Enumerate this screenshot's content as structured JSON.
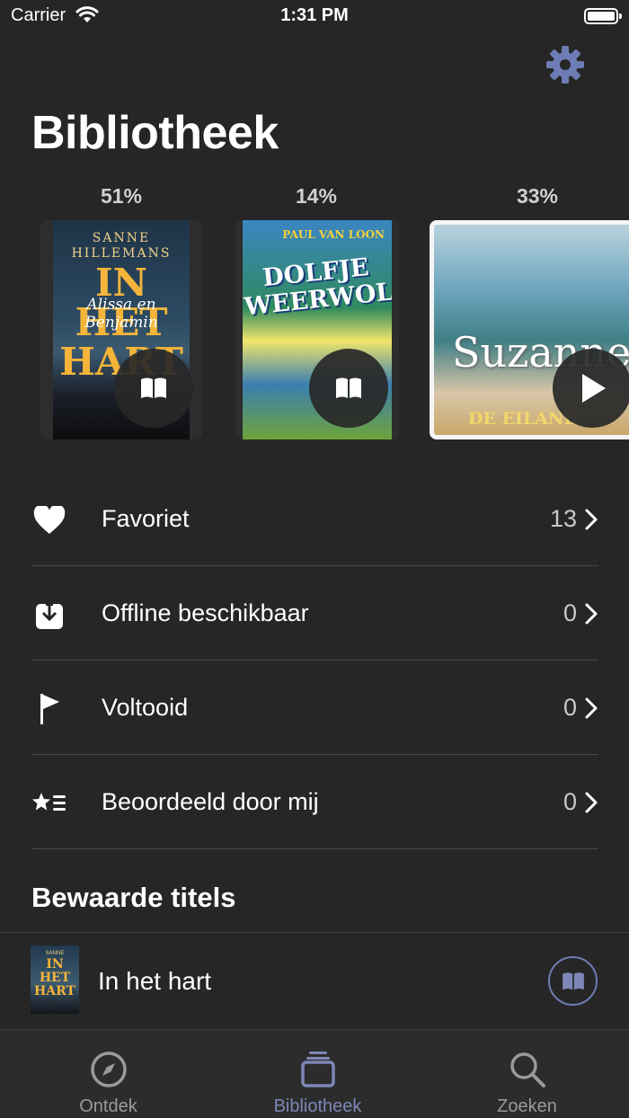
{
  "status_bar": {
    "carrier": "Carrier",
    "time": "1:31 PM"
  },
  "header": {
    "title": "Bibliotheek",
    "settings_icon": "gear-icon"
  },
  "carousel": [
    {
      "progress": "51%",
      "cover_author": "SANNE HILLEMANS",
      "cover_title": "IN HET HART",
      "cover_subtitle": "Alissa en Benjamin",
      "action_icon": "open-book-icon"
    },
    {
      "progress": "14%",
      "cover_author": "PAUL VAN LOON",
      "cover_title": "DOLFJE WEERWOLFJE",
      "action_icon": "open-book-icon"
    },
    {
      "progress": "33%",
      "cover_author": "Suzanne Vermeer",
      "cover_subtitle": "DE EILAND",
      "action_icon": "play-icon"
    }
  ],
  "menu": [
    {
      "label": "Favoriet",
      "count": "13",
      "icon": "heart-icon"
    },
    {
      "label": "Offline beschikbaar",
      "count": "0",
      "icon": "download-icon"
    },
    {
      "label": "Voltooid",
      "count": "0",
      "icon": "flag-icon"
    },
    {
      "label": "Beoordeeld door mij",
      "count": "0",
      "icon": "rated-list-icon"
    }
  ],
  "saved": {
    "section_title": "Bewaarde titels",
    "items": [
      {
        "title": "In het hart",
        "thumb_author": "SANNE",
        "thumb_title": "IN HET HART",
        "action_icon": "open-book-icon"
      }
    ]
  },
  "tabs": [
    {
      "label": "Ontdek",
      "icon": "compass-icon",
      "active": false
    },
    {
      "label": "Bibliotheek",
      "icon": "library-icon",
      "active": true
    },
    {
      "label": "Zoeken",
      "icon": "search-icon",
      "active": false
    }
  ],
  "colors": {
    "background": "#262626",
    "accent": "#7d87b8",
    "settings_icon": "#6e7cb5"
  }
}
